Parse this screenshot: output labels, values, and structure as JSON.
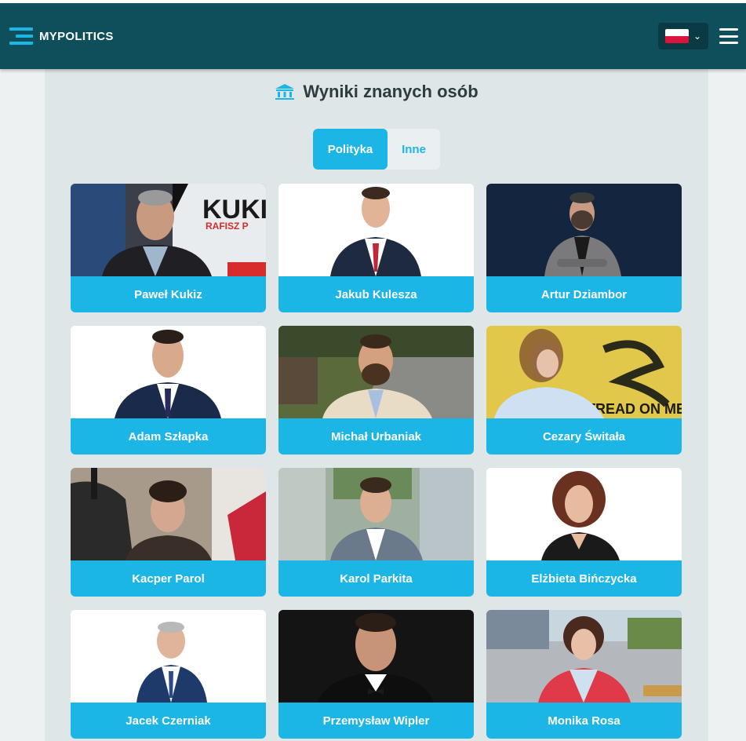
{
  "header": {
    "brand": "MYPOLITICS",
    "language": "pl"
  },
  "page": {
    "title": "Wyniki znanych osób",
    "title_icon": "institution-icon"
  },
  "tabs": [
    {
      "label": "Polityka",
      "active": true
    },
    {
      "label": "Inne",
      "active": false
    }
  ],
  "people": [
    {
      "name": "Paweł Kukiz"
    },
    {
      "name": "Jakub Kulesza"
    },
    {
      "name": "Artur Dziambor"
    },
    {
      "name": "Adam Szłapka"
    },
    {
      "name": "Michał Urbaniak"
    },
    {
      "name": "Cezary Świtała"
    },
    {
      "name": "Kacper Parol"
    },
    {
      "name": "Karol Parkita"
    },
    {
      "name": "Elżbieta Bińczycka"
    },
    {
      "name": "Jacek Czerniak"
    },
    {
      "name": "Przemysław Wipler"
    },
    {
      "name": "Monika Rosa"
    }
  ],
  "photo_texts": {
    "kukiz_banner": "KUKI",
    "kukiz_sub": "RAFISZ P",
    "flag_text": "T TREAD ON ME"
  },
  "colors": {
    "navbar": "#0f4f5c",
    "accent": "#1bb5e6",
    "content_bg": "#dfe6e8"
  }
}
